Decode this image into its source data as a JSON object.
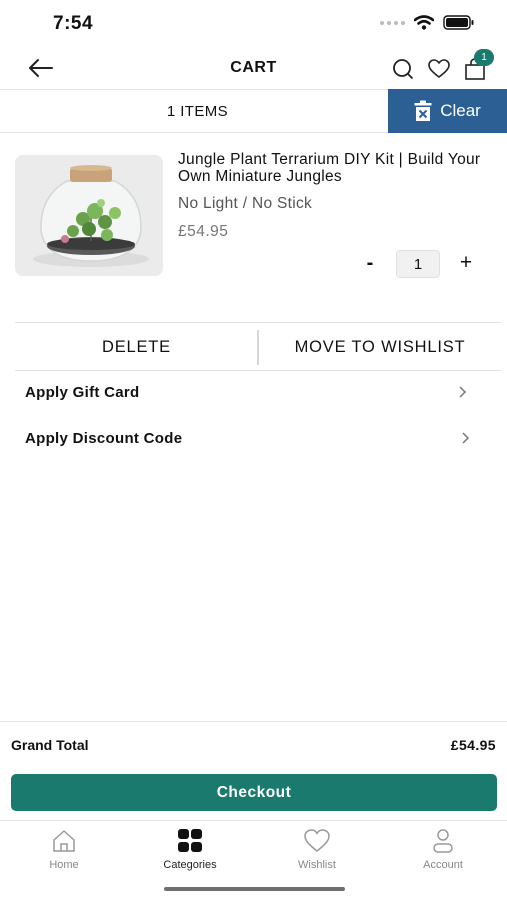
{
  "status_bar": {
    "time": "7:54"
  },
  "header": {
    "title": "CART",
    "cart_badge": "1"
  },
  "items_bar": {
    "count_label": "1 ITEMS",
    "clear_label": "Clear"
  },
  "product": {
    "name": "Jungle Plant Terrarium DIY Kit | Build Your Own Miniature Jungles",
    "variant": "No Light / No Stick",
    "price": "£54.95",
    "quantity": "1",
    "minus_label": "-",
    "plus_label": "+"
  },
  "actions": {
    "delete_label": "DELETE",
    "wishlist_label": "MOVE TO WISHLIST"
  },
  "options": [
    {
      "label": "Apply Gift Card"
    },
    {
      "label": "Apply Discount Code"
    }
  ],
  "summary": {
    "total_label": "Grand Total",
    "total_value": "£54.95",
    "checkout_label": "Checkout"
  },
  "tabs": [
    {
      "label": "Home",
      "icon": "home-icon"
    },
    {
      "label": "Categories",
      "icon": "categories-icon",
      "active": true
    },
    {
      "label": "Wishlist",
      "icon": "heart-icon"
    },
    {
      "label": "Account",
      "icon": "account-icon"
    }
  ],
  "colors": {
    "accent": "#1b7a6e",
    "clear_button": "#2c5f93"
  }
}
